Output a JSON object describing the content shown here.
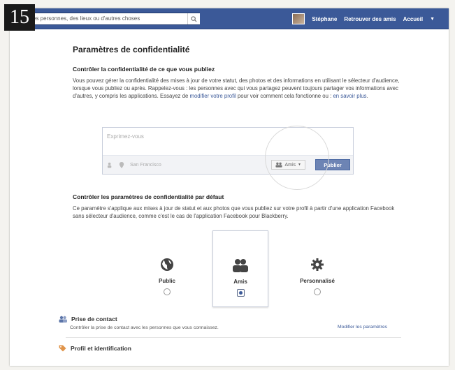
{
  "step_number": "15",
  "topbar": {
    "search_value": "ouvez des personnes, des lieux ou d'autres choses",
    "user_name": "Stéphane",
    "find_friends": "Retrouver des amis",
    "home": "Accueil",
    "caret": "▼"
  },
  "page": {
    "title": "Paramètres de confidentialité",
    "section1": {
      "heading": "Contrôler la confidentialité de ce que vous publiez",
      "text_start": "Vous pouvez gérer la confidentialité des mises à jour de votre statut, des photos et des informations en utilisant le sélecteur d'audience, lorsque vous publiez ou après. Rappelez-vous : les personnes avec qui vous partagez peuvent toujours partager vos informations avec d'autres, y compris les applications. Essayez de ",
      "link1": "modifier votre profil",
      "text_mid": " pour voir comment cela fonctionne ou : ",
      "link2": "en savoir plus",
      "text_end": "."
    },
    "composer": {
      "placeholder": "Exprimez-vous",
      "location": "San Francisco",
      "audience": "Amis",
      "audience_caret": "▼",
      "publish": "Publier"
    },
    "section2": {
      "heading": "Contrôler les paramètres de confidentialité par défaut",
      "text": "Ce paramètre s'applique aux mises à jour de statut et aux photos que vous publiez sur votre profil à partir d'une application Facebook sans sélecteur d'audience, comme c'est le cas de l'application Facebook pour Blackberry."
    },
    "audience_options": [
      {
        "label": "Public",
        "icon": "globe-icon",
        "selected": false
      },
      {
        "label": "Amis",
        "icon": "friends-icon",
        "selected": true
      },
      {
        "label": "Personnalisé",
        "icon": "gear-icon",
        "selected": false
      }
    ],
    "settings_rows": [
      {
        "title": "Prise de contact",
        "subtitle": "Contrôler la prise de contact avec les personnes que vous connaissez.",
        "link": "Modifier les paramètres",
        "icon": "contacts-icon"
      },
      {
        "title": "Profil et identification",
        "icon": "tag-icon"
      }
    ]
  },
  "colors": {
    "facebook_blue": "#3b5998",
    "publish_button": "#6d84b4"
  }
}
